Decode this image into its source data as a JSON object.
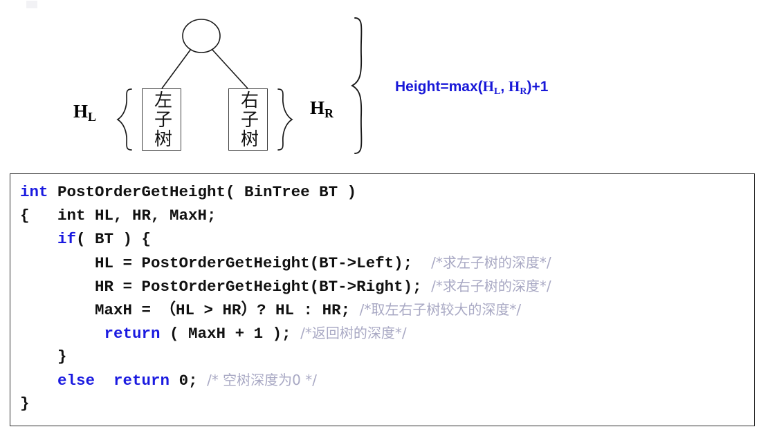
{
  "diagram": {
    "root_node": "root-circle",
    "left_subtree_label": "左子树",
    "right_subtree_label": "右子树",
    "height_left_base": "H",
    "height_left_sub": "L",
    "height_right_base": "H",
    "height_right_sub": "R",
    "formula": {
      "prefix": "Height=max(",
      "h1_base": "H",
      "h1_sub": "L",
      "separator": ", ",
      "h2_base": "H",
      "h2_sub": "R",
      "suffix": ")+1",
      "color": "#1818d8"
    }
  },
  "code": {
    "language": "c",
    "keyword_color": "#1a1ae0",
    "comment_color": "#a9a9c4",
    "text_color": "#111111",
    "border_color": "#2b2b2b",
    "lines": [
      {
        "id": "line-1",
        "segments": [
          {
            "type": "keyword",
            "text": "int"
          },
          {
            "type": "text",
            "text": " PostOrderGetHeight( BinTree BT )"
          }
        ]
      },
      {
        "id": "line-2",
        "segments": [
          {
            "type": "text",
            "text": "{   int HL, HR, MaxH;"
          }
        ]
      },
      {
        "id": "line-3",
        "segments": [
          {
            "type": "text",
            "text": "    "
          },
          {
            "type": "keyword",
            "text": "if"
          },
          {
            "type": "text",
            "text": "( BT ) {"
          }
        ]
      },
      {
        "id": "line-4",
        "segments": [
          {
            "type": "text",
            "text": "        HL = PostOrderGetHeight(BT->Left);  "
          },
          {
            "type": "comment",
            "text": "/*求左子树的深度*/"
          }
        ]
      },
      {
        "id": "line-5",
        "segments": [
          {
            "type": "text",
            "text": "        HR = PostOrderGetHeight(BT->Right); "
          },
          {
            "type": "comment",
            "text": "/*求右子树的深度*/"
          }
        ]
      },
      {
        "id": "line-6",
        "segments": [
          {
            "type": "text",
            "text": "        MaxH = （HL > HR）? HL : HR; "
          },
          {
            "type": "comment",
            "text": "/*取左右子树较大的深度*/"
          }
        ]
      },
      {
        "id": "line-7",
        "segments": [
          {
            "type": "text",
            "text": "         "
          },
          {
            "type": "keyword",
            "text": "return"
          },
          {
            "type": "text",
            "text": " ( MaxH + 1 ); "
          },
          {
            "type": "comment",
            "text": "/*返回树的深度*/"
          }
        ]
      },
      {
        "id": "line-8",
        "segments": [
          {
            "type": "text",
            "text": "    }"
          }
        ]
      },
      {
        "id": "line-9",
        "segments": [
          {
            "type": "text",
            "text": "    "
          },
          {
            "type": "keyword",
            "text": "else"
          },
          {
            "type": "text",
            "text": "  "
          },
          {
            "type": "keyword",
            "text": "return"
          },
          {
            "type": "text",
            "text": " 0; "
          },
          {
            "type": "comment",
            "text": "/* 空树深度为0 */"
          }
        ]
      },
      {
        "id": "line-10",
        "segments": [
          {
            "type": "text",
            "text": "}"
          }
        ]
      }
    ]
  }
}
